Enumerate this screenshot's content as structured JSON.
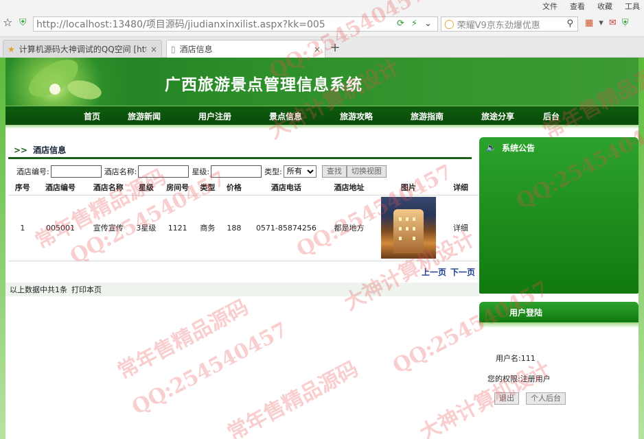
{
  "browser": {
    "menu": [
      "文件",
      "查看",
      "收藏",
      "工具"
    ],
    "url": "http://localhost:13480/项目源码/jiudianxinxilist.aspx?kk=005",
    "search_placeholder": "荣耀V9京东劲爆优惠",
    "tabs": [
      {
        "label": "计算机源码大神调试的QQ空间 [http://",
        "active": false
      },
      {
        "label": "酒店信息",
        "active": true
      }
    ],
    "new_tab": "+"
  },
  "header": {
    "site_title": "广西旅游景点管理信息系统"
  },
  "nav": {
    "items": [
      "首页",
      "旅游新闻",
      "用户注册",
      "景点信息",
      "旅游攻略",
      "旅游指南",
      "旅途分享",
      "后台"
    ]
  },
  "section": {
    "arrows": ">>",
    "title": "酒店信息"
  },
  "filters": {
    "hotel_no_label": "酒店编号:",
    "hotel_no_value": "",
    "hotel_name_label": "酒店名称:",
    "hotel_name_value": "",
    "star_label": "星级:",
    "star_value": "",
    "type_label": "类型:",
    "type_selected": "所有",
    "search_button": "查找",
    "switch_button": "切换视图"
  },
  "table": {
    "columns": [
      "序号",
      "酒店编号",
      "酒店名称",
      "星级",
      "房间号",
      "类型",
      "价格",
      "酒店电话",
      "酒店地址",
      "图片",
      "详细"
    ],
    "rows": [
      {
        "index": "1",
        "hotel_no": "005001",
        "hotel_name": "宣传宣传",
        "star": "3星级",
        "room_no": "1121",
        "type": "商务",
        "price": "188",
        "phone": "0571-85874256",
        "address": "都是地方",
        "detail": "详细"
      }
    ]
  },
  "pager": {
    "prev": "上一页",
    "next": "下一页"
  },
  "summary": {
    "count_text": "以上数据中共1条",
    "print_text": "打印本页"
  },
  "sidebar": {
    "notice_title": "系统公告",
    "login_title": "用户登陆",
    "username_line": "用户名:111",
    "permission_line": "您的权限:注册用户",
    "logout_button": "退出",
    "backend_button": "个人后台"
  },
  "watermarks": [
    "QQ:254540457",
    "大神计算机设计",
    "常年售精品源码"
  ]
}
